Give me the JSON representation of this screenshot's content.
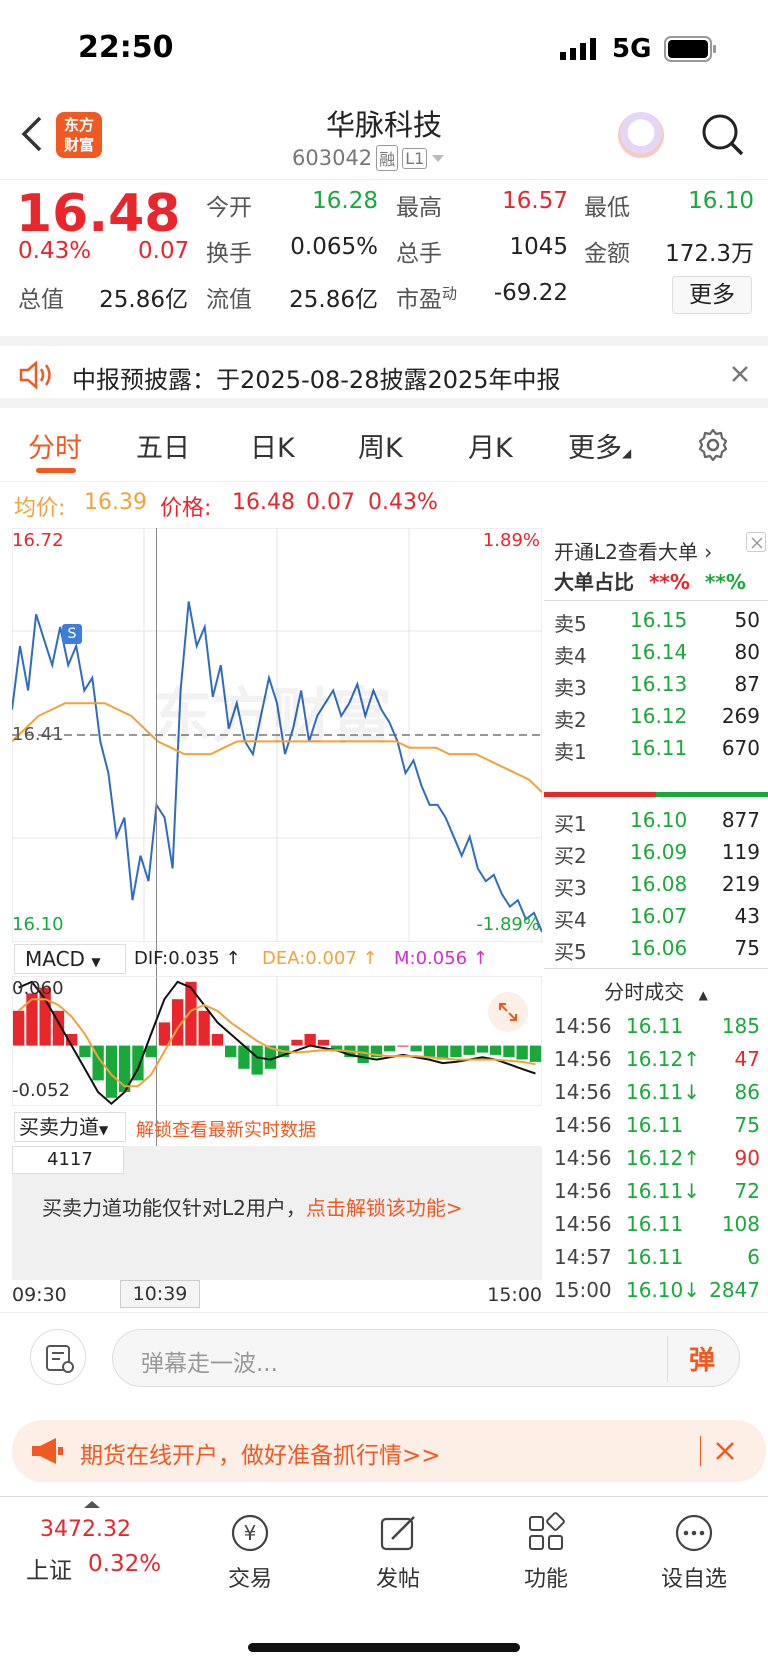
{
  "status": {
    "time": "22:50",
    "network": "5G"
  },
  "nav": {
    "stock_name": "华脉科技",
    "stock_code": "603042",
    "badge_rong": "融",
    "badge_level": "L1",
    "logo_text": "东方财富"
  },
  "quote": {
    "price": "16.48",
    "change_pct": "0.43%",
    "change": "0.07",
    "open_label": "今开",
    "open": "16.28",
    "high_label": "最高",
    "high": "16.57",
    "low_label": "最低",
    "low": "16.10",
    "turnover_label": "换手",
    "turnover": "0.065%",
    "volume_label": "总手",
    "volume": "1045",
    "amount_label": "金额",
    "amount": "172.3万",
    "mktcap_label": "总值",
    "mktcap": "25.86亿",
    "float_label": "流值",
    "float_cap": "25.86亿",
    "pe_label": "市盈",
    "pe_sup": "动",
    "pe": "-69.22",
    "more": "更多"
  },
  "notice": {
    "text": "中报预披露：于2025-08-28披露2025年中报"
  },
  "tabs": [
    {
      "label": "分时",
      "active": true
    },
    {
      "label": "五日"
    },
    {
      "label": "日K"
    },
    {
      "label": "周K"
    },
    {
      "label": "月K"
    },
    {
      "label": "更多"
    }
  ],
  "info": {
    "avg_label": "均价:",
    "avg": "16.39",
    "price_label": "价格:",
    "price": "16.48",
    "chg": "0.07",
    "pct": "0.43%"
  },
  "chart_labels": {
    "top_price": "16.72",
    "top_pct": "1.89%",
    "mid_price": "16.41",
    "bottom_price": "16.10",
    "bottom_pct": "-1.89%",
    "marker": "S",
    "watermark": "东方财富"
  },
  "macd": {
    "label": "MACD",
    "dif": "DIF:0.035 ↑",
    "dea": "DEA:0.007 ↑",
    "m": "M:0.056 ↑",
    "top": "0.060",
    "bottom": "-0.052"
  },
  "power": {
    "label": "买卖力道",
    "unlock_hint": "解锁查看最新实时数据",
    "value": "4117",
    "lock_text": "买卖力道功能仅针对L2用户，",
    "lock_link": "点击解锁该功能>"
  },
  "time_axis": {
    "start": "09:30",
    "cursor": "10:39",
    "end": "15:00"
  },
  "level2": {
    "title": "开通L2查看大单 ›",
    "ratio_label": "大单占比",
    "ratio_red": "**%",
    "ratio_green": "**%"
  },
  "sells": [
    {
      "label": "卖5",
      "price": "16.15",
      "vol": "50"
    },
    {
      "label": "卖4",
      "price": "16.14",
      "vol": "80"
    },
    {
      "label": "卖3",
      "price": "16.13",
      "vol": "87"
    },
    {
      "label": "卖2",
      "price": "16.12",
      "vol": "269"
    },
    {
      "label": "卖1",
      "price": "16.11",
      "vol": "670"
    }
  ],
  "buys": [
    {
      "label": "买1",
      "price": "16.10",
      "vol": "877"
    },
    {
      "label": "买2",
      "price": "16.09",
      "vol": "119"
    },
    {
      "label": "买3",
      "price": "16.08",
      "vol": "219"
    },
    {
      "label": "买4",
      "price": "16.07",
      "vol": "43"
    },
    {
      "label": "买5",
      "price": "16.06",
      "vol": "75"
    }
  ],
  "ticks_title": "分时成交",
  "ticks": [
    {
      "time": "14:56",
      "price": "16.11",
      "vol": "185",
      "dir": ""
    },
    {
      "time": "14:56",
      "price": "16.12↑",
      "vol": "47",
      "dir": "up"
    },
    {
      "time": "14:56",
      "price": "16.11↓",
      "vol": "86",
      "dir": "down"
    },
    {
      "time": "14:56",
      "price": "16.11",
      "vol": "75",
      "dir": ""
    },
    {
      "time": "14:56",
      "price": "16.12↑",
      "vol": "90",
      "dir": "up"
    },
    {
      "time": "14:56",
      "price": "16.11↓",
      "vol": "72",
      "dir": "down"
    },
    {
      "time": "14:56",
      "price": "16.11",
      "vol": "108",
      "dir": ""
    },
    {
      "time": "14:57",
      "price": "16.11",
      "vol": "6",
      "dir": ""
    },
    {
      "time": "15:00",
      "price": "16.10↓",
      "vol": "2847",
      "dir": "down"
    }
  ],
  "danmu": {
    "placeholder": "弹幕走一波...",
    "send": "弹"
  },
  "ad": {
    "text": "期货在线开户，做好准备抓行情>>"
  },
  "bottom": {
    "index_value": "3472.32",
    "index_name": "上证",
    "index_pct": "0.32%",
    "items": [
      {
        "label": "交易"
      },
      {
        "label": "发帖"
      },
      {
        "label": "功能"
      },
      {
        "label": "设自选"
      }
    ]
  },
  "chart_data": {
    "type": "line",
    "x_range": [
      "09:30",
      "15:00"
    ],
    "ylim": [
      16.1,
      16.72
    ],
    "pct_range": [
      "-1.89%",
      "1.89%"
    ],
    "prev_close": 16.41,
    "series": [
      {
        "name": "价格",
        "values": [
          16.45,
          16.55,
          16.48,
          16.6,
          16.56,
          16.52,
          16.58,
          16.52,
          16.55,
          16.48,
          16.5,
          16.4,
          16.35,
          16.25,
          16.28,
          16.15,
          16.22,
          16.18,
          16.3,
          16.28,
          16.2,
          16.48,
          16.62,
          16.55,
          16.58,
          16.47,
          16.52,
          16.42,
          16.46,
          16.4,
          16.38,
          16.44,
          16.5,
          16.46,
          16.38,
          16.42,
          16.48,
          16.4,
          16.44,
          16.46,
          16.48,
          16.44,
          16.46,
          16.49,
          16.44,
          16.48,
          16.45,
          16.43,
          16.4,
          16.35,
          16.37,
          16.33,
          16.3,
          16.3,
          16.28,
          16.25,
          16.22,
          16.25,
          16.2,
          16.18,
          16.19,
          16.16,
          16.14,
          16.15,
          16.12,
          16.13,
          16.1
        ]
      },
      {
        "name": "均价",
        "values": [
          16.4,
          16.42,
          16.44,
          16.45,
          16.46,
          16.46,
          16.46,
          16.46,
          16.45,
          16.44,
          16.42,
          16.4,
          16.39,
          16.38,
          16.38,
          16.38,
          16.39,
          16.4,
          16.4,
          16.4,
          16.4,
          16.4,
          16.4,
          16.4,
          16.4,
          16.4,
          16.4,
          16.4,
          16.4,
          16.4,
          16.39,
          16.39,
          16.39,
          16.38,
          16.38,
          16.38,
          16.37,
          16.36,
          16.35,
          16.34,
          16.32
        ]
      }
    ]
  },
  "macd_data": {
    "ylim": [
      -0.052,
      0.06
    ],
    "hist": [
      0.03,
      0.045,
      0.05,
      0.03,
      0.01,
      -0.01,
      -0.03,
      -0.045,
      -0.04,
      -0.03,
      -0.01,
      0.02,
      0.04,
      0.055,
      0.03,
      0.01,
      -0.01,
      -0.02,
      -0.025,
      -0.02,
      -0.01,
      0.005,
      0.01,
      0.005,
      -0.005,
      -0.01,
      -0.015,
      -0.01,
      -0.005,
      0.0,
      -0.005,
      -0.01,
      -0.012,
      -0.01,
      -0.008,
      -0.006,
      -0.008,
      -0.01,
      -0.012,
      -0.014
    ],
    "dif": [
      0.05,
      0.055,
      0.04,
      0.02,
      0.0,
      -0.02,
      -0.04,
      -0.05,
      -0.04,
      -0.02,
      0.01,
      0.04,
      0.055,
      0.05,
      0.035,
      0.02,
      0.01,
      0.0,
      -0.01,
      -0.012,
      -0.008,
      -0.004,
      0.0,
      -0.002,
      -0.004,
      -0.008,
      -0.01,
      -0.012,
      -0.01,
      -0.008,
      -0.01,
      -0.012,
      -0.015,
      -0.014,
      -0.012,
      -0.01,
      -0.012,
      -0.016,
      -0.02,
      -0.024
    ],
    "dea": [
      0.03,
      0.04,
      0.04,
      0.035,
      0.025,
      0.01,
      -0.01,
      -0.025,
      -0.035,
      -0.035,
      -0.025,
      -0.005,
      0.015,
      0.03,
      0.035,
      0.03,
      0.02,
      0.012,
      0.004,
      -0.002,
      -0.005,
      -0.006,
      -0.005,
      -0.004,
      -0.004,
      -0.005,
      -0.006,
      -0.008,
      -0.009,
      -0.009,
      -0.009,
      -0.01,
      -0.011,
      -0.012,
      -0.012,
      -0.012,
      -0.012,
      -0.013,
      -0.014,
      -0.016
    ]
  }
}
